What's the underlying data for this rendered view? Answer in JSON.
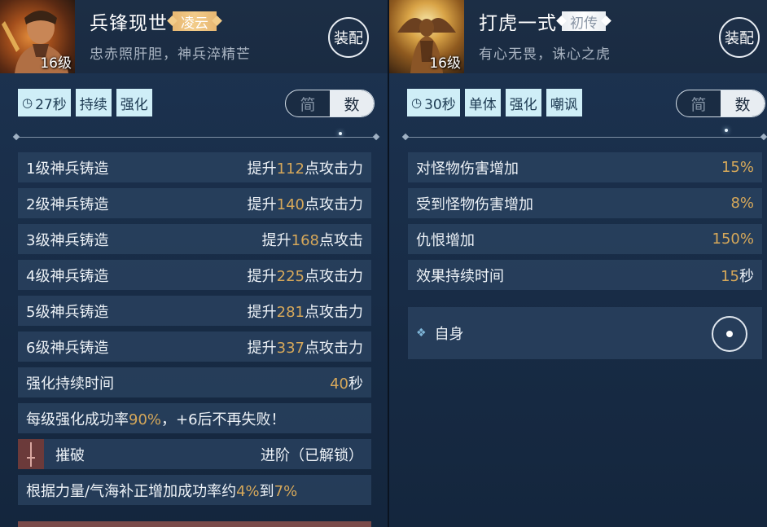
{
  "left": {
    "title": "兵锋现世",
    "rank": "凌云",
    "subtitle": "忠赤照肝胆，神兵淬精芒",
    "level": "16级",
    "equip_label": "装配",
    "tags": [
      "27秒",
      "持续",
      "强化"
    ],
    "toggle": {
      "simple": "简",
      "numeric": "数"
    },
    "rows": [
      {
        "label": "1级神兵铸造",
        "pre": "提升",
        "value": "112",
        "post": "点攻击力"
      },
      {
        "label": "2级神兵铸造",
        "pre": "提升",
        "value": "140",
        "post": "点攻击力"
      },
      {
        "label": "3级神兵铸造",
        "pre": "提升",
        "value": "168",
        "post": "点攻击"
      },
      {
        "label": "4级神兵铸造",
        "pre": "提升",
        "value": "225",
        "post": "点攻击力"
      },
      {
        "label": "5级神兵铸造",
        "pre": "提升",
        "value": "281",
        "post": "点攻击力"
      },
      {
        "label": "6级神兵铸造",
        "pre": "提升",
        "value": "337",
        "post": "点攻击力"
      }
    ],
    "duration": {
      "label": "强化持续时间",
      "value": "40",
      "unit": "秒"
    },
    "success": {
      "pre": "每级强化成功率",
      "value": "90%",
      "post": "，+6后不再失败！"
    },
    "cuipo": {
      "name": "摧破",
      "status": "进阶（已解锁）"
    },
    "bonus": {
      "pre": "根据力量/气海补正增加成功率约",
      "v1": "4%",
      "mid": "到",
      "v2": "7%"
    }
  },
  "right": {
    "title": "打虎一式",
    "rank": "初传",
    "subtitle": "有心无畏，诛心之虎",
    "level": "16级",
    "equip_label": "装配",
    "tags": [
      "30秒",
      "单体",
      "强化",
      "嘲讽"
    ],
    "toggle": {
      "simple": "简",
      "numeric": "数"
    },
    "rows": [
      {
        "label": "对怪物伤害增加",
        "value": "15%",
        "unit": ""
      },
      {
        "label": "受到怪物伤害增加",
        "value": "8%",
        "unit": ""
      },
      {
        "label": "仇恨增加",
        "value": "150%",
        "unit": ""
      },
      {
        "label": "效果持续时间",
        "value": "15",
        "unit": "秒"
      }
    ],
    "target": {
      "label": "自身"
    }
  }
}
